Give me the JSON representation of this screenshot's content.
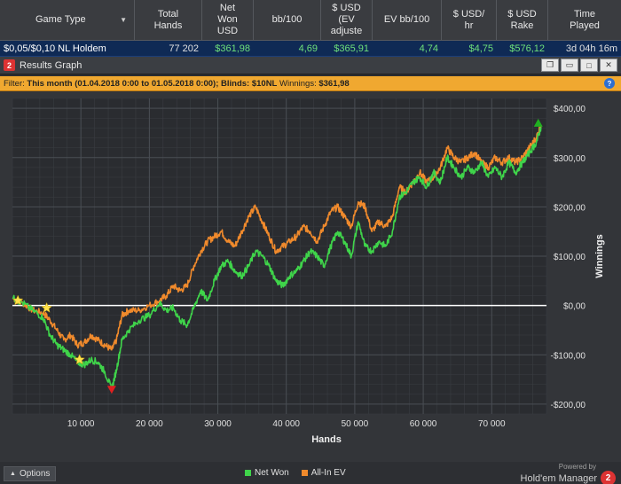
{
  "table": {
    "headers": [
      {
        "label": "Game Type",
        "has_dropdown": true
      },
      {
        "label": "Total\nHands"
      },
      {
        "label": "Net\nWon\nUSD"
      },
      {
        "label": "bb/100"
      },
      {
        "label": "$ USD\n(EV\nadjuste"
      },
      {
        "label": "EV bb/100"
      },
      {
        "label": "$ USD/\nhr"
      },
      {
        "label": "$ USD\nRake"
      },
      {
        "label": "Time\nPlayed"
      }
    ],
    "row": [
      "$0,05/$0,10 NL Holdem",
      "77 202",
      "$361,98",
      "4,69",
      "$365,91",
      "4,74",
      "$4,75",
      "$576,12",
      "3d 04h 16m"
    ]
  },
  "window": {
    "title": "Results Graph",
    "logo_text": "2",
    "buttons": {
      "restore": "❐",
      "minimize": "▭",
      "maximize": "□",
      "close": "✕"
    }
  },
  "filter": {
    "prefix": "Filter: ",
    "date_range": "This month (01.04.2018 0:00 to 01.05.2018 0:00)",
    "blinds_label": "; Blinds: ",
    "blinds_value": "$10NL",
    "winnings_label": " Winnings: ",
    "winnings_value": "$361,98",
    "help_icon": "?"
  },
  "chart_data": {
    "type": "line",
    "xlabel": "Hands",
    "ylabel": "Winnings",
    "xlim": [
      0,
      78000
    ],
    "ylim": [
      -220,
      420
    ],
    "xticks": [
      10000,
      20000,
      30000,
      40000,
      50000,
      60000,
      70000
    ],
    "xtick_labels": [
      "10 000",
      "20 000",
      "30 000",
      "40 000",
      "50 000",
      "60 000",
      "70 000"
    ],
    "yticks": [
      -200,
      -100,
      0,
      100,
      200,
      300,
      400
    ],
    "ytick_labels": [
      "-$200,00",
      "-$100,00",
      "$0,00",
      "$100,00",
      "$200,00",
      "$300,00",
      "$400,00"
    ],
    "grid": true,
    "legend_position": "bottom-center",
    "series": [
      {
        "name": "Net Won",
        "color": "#3fd44a",
        "points": [
          [
            0,
            15
          ],
          [
            1500,
            5
          ],
          [
            3000,
            -10
          ],
          [
            4500,
            -25
          ],
          [
            5500,
            -60
          ],
          [
            6500,
            -80
          ],
          [
            7500,
            -90
          ],
          [
            8500,
            -100
          ],
          [
            9500,
            -115
          ],
          [
            10500,
            -120
          ],
          [
            11500,
            -110
          ],
          [
            12500,
            -115
          ],
          [
            13500,
            -135
          ],
          [
            14500,
            -170
          ],
          [
            15200,
            -130
          ],
          [
            16000,
            -70
          ],
          [
            17000,
            -50
          ],
          [
            18500,
            -30
          ],
          [
            20000,
            -20
          ],
          [
            21500,
            5
          ],
          [
            22500,
            -10
          ],
          [
            23500,
            -5
          ],
          [
            24500,
            -30
          ],
          [
            25500,
            -40
          ],
          [
            26500,
            -5
          ],
          [
            27500,
            30
          ],
          [
            28500,
            10
          ],
          [
            29500,
            50
          ],
          [
            30500,
            80
          ],
          [
            31500,
            90
          ],
          [
            32500,
            70
          ],
          [
            33500,
            60
          ],
          [
            34500,
            80
          ],
          [
            35500,
            110
          ],
          [
            36500,
            100
          ],
          [
            37500,
            80
          ],
          [
            38500,
            50
          ],
          [
            39500,
            40
          ],
          [
            40500,
            60
          ],
          [
            41500,
            70
          ],
          [
            42500,
            90
          ],
          [
            43500,
            110
          ],
          [
            44500,
            100
          ],
          [
            45500,
            80
          ],
          [
            46500,
            120
          ],
          [
            47500,
            150
          ],
          [
            48500,
            130
          ],
          [
            49500,
            100
          ],
          [
            50500,
            170
          ],
          [
            51500,
            120
          ],
          [
            52500,
            110
          ],
          [
            53500,
            130
          ],
          [
            54500,
            120
          ],
          [
            55500,
            150
          ],
          [
            56500,
            220
          ],
          [
            57500,
            230
          ],
          [
            58500,
            250
          ],
          [
            59500,
            260
          ],
          [
            60500,
            240
          ],
          [
            61500,
            270
          ],
          [
            62500,
            250
          ],
          [
            63500,
            300
          ],
          [
            64500,
            280
          ],
          [
            65500,
            260
          ],
          [
            66500,
            280
          ],
          [
            67500,
            270
          ],
          [
            68500,
            290
          ],
          [
            69500,
            260
          ],
          [
            70500,
            280
          ],
          [
            71500,
            260
          ],
          [
            72500,
            290
          ],
          [
            73500,
            270
          ],
          [
            74500,
            290
          ],
          [
            75500,
            310
          ],
          [
            76500,
            330
          ],
          [
            77200,
            362
          ]
        ]
      },
      {
        "name": "All-In EV",
        "color": "#f08a2c",
        "points": [
          [
            0,
            15
          ],
          [
            1500,
            5
          ],
          [
            3000,
            -10
          ],
          [
            4500,
            -15
          ],
          [
            5500,
            -30
          ],
          [
            6500,
            -50
          ],
          [
            7500,
            -70
          ],
          [
            8500,
            -60
          ],
          [
            9500,
            -80
          ],
          [
            10500,
            -75
          ],
          [
            11500,
            -60
          ],
          [
            12500,
            -70
          ],
          [
            13500,
            -80
          ],
          [
            14500,
            -90
          ],
          [
            15200,
            -70
          ],
          [
            16000,
            -20
          ],
          [
            17000,
            -10
          ],
          [
            18500,
            -10
          ],
          [
            20000,
            0
          ],
          [
            21500,
            10
          ],
          [
            22500,
            20
          ],
          [
            23500,
            40
          ],
          [
            24500,
            30
          ],
          [
            25500,
            40
          ],
          [
            26500,
            80
          ],
          [
            27500,
            110
          ],
          [
            28500,
            130
          ],
          [
            29500,
            140
          ],
          [
            30500,
            150
          ],
          [
            31500,
            130
          ],
          [
            32500,
            120
          ],
          [
            33500,
            150
          ],
          [
            34500,
            180
          ],
          [
            35500,
            200
          ],
          [
            36500,
            170
          ],
          [
            37500,
            140
          ],
          [
            38500,
            110
          ],
          [
            39500,
            120
          ],
          [
            40500,
            130
          ],
          [
            41500,
            140
          ],
          [
            42500,
            160
          ],
          [
            43500,
            150
          ],
          [
            44500,
            130
          ],
          [
            45500,
            160
          ],
          [
            46500,
            190
          ],
          [
            47500,
            200
          ],
          [
            48500,
            180
          ],
          [
            49500,
            160
          ],
          [
            50500,
            210
          ],
          [
            51500,
            200
          ],
          [
            52500,
            150
          ],
          [
            53500,
            170
          ],
          [
            54500,
            160
          ],
          [
            55500,
            180
          ],
          [
            56500,
            240
          ],
          [
            57500,
            230
          ],
          [
            58500,
            250
          ],
          [
            59500,
            270
          ],
          [
            60500,
            250
          ],
          [
            61500,
            260
          ],
          [
            62500,
            280
          ],
          [
            63500,
            320
          ],
          [
            64500,
            300
          ],
          [
            65500,
            290
          ],
          [
            66500,
            300
          ],
          [
            67500,
            310
          ],
          [
            68500,
            290
          ],
          [
            69500,
            280
          ],
          [
            70500,
            300
          ],
          [
            71500,
            290
          ],
          [
            72500,
            300
          ],
          [
            73500,
            290
          ],
          [
            74500,
            300
          ],
          [
            75500,
            320
          ],
          [
            76500,
            340
          ],
          [
            77200,
            366
          ]
        ]
      }
    ],
    "markers": [
      {
        "type": "star",
        "color": "#ffe14a",
        "x": 800,
        "y": 10
      },
      {
        "type": "star",
        "color": "#ffe14a",
        "x": 5000,
        "y": -5
      },
      {
        "type": "star",
        "color": "#ffe14a",
        "x": 9800,
        "y": -110
      },
      {
        "type": "triangle-down",
        "color": "#e02020",
        "x": 14500,
        "y": -170
      },
      {
        "type": "triangle-up",
        "color": "#20b020",
        "x": 76800,
        "y": 370
      }
    ],
    "zero_line_color": "#ffffff"
  },
  "footer": {
    "options_label": "Options",
    "legend": [
      {
        "label": "Net Won",
        "color": "#3fd44a"
      },
      {
        "label": "All-In EV",
        "color": "#f08a2c"
      }
    ],
    "powered_by": "Powered by",
    "brand": "Hold'em Manager",
    "brand_logo": "2"
  }
}
